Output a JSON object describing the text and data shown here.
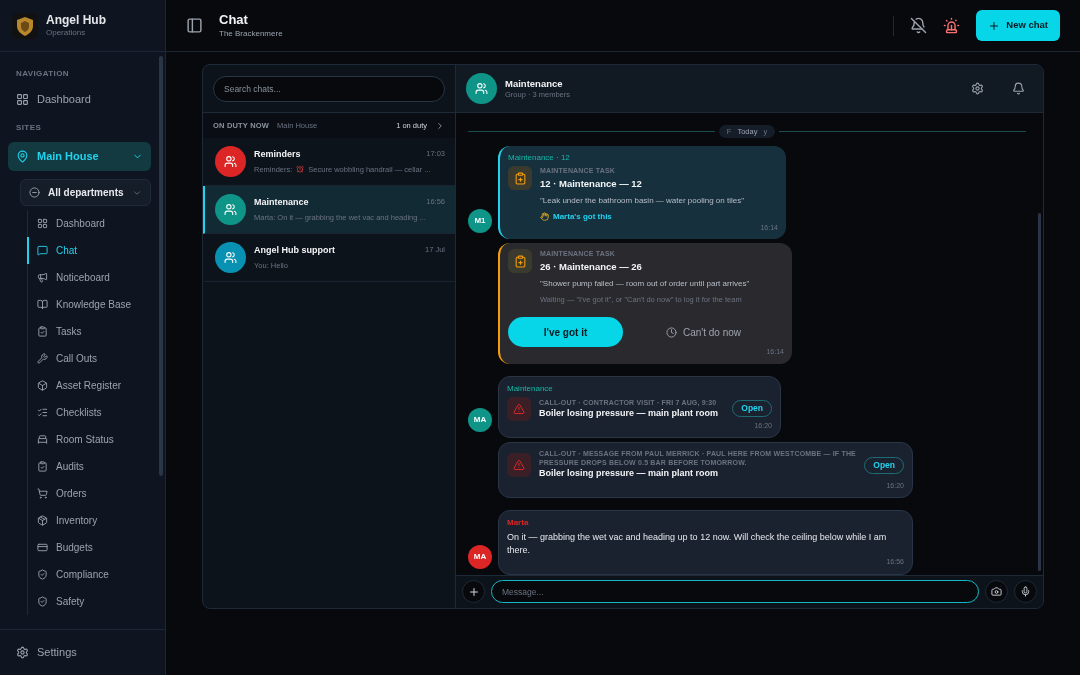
{
  "brand": {
    "name": "Angel Hub",
    "subtitle": "Operations"
  },
  "sidebar": {
    "nav_heading": "NAVIGATION",
    "nav_items": [
      {
        "label": "Dashboard",
        "selected": false
      }
    ],
    "sites_heading": "SITES",
    "site": {
      "label": "Main House"
    },
    "department": {
      "label": "All departments"
    },
    "items": [
      {
        "label": "Dashboard",
        "selected": false
      },
      {
        "label": "Chat",
        "selected": true
      },
      {
        "label": "Noticeboard",
        "selected": false
      },
      {
        "label": "Knowledge Base",
        "selected": false
      },
      {
        "label": "Tasks",
        "selected": false
      },
      {
        "label": "Call Outs",
        "selected": false
      },
      {
        "label": "Asset Register",
        "selected": false
      },
      {
        "label": "Checklists",
        "selected": false
      },
      {
        "label": "Room Status",
        "selected": false
      },
      {
        "label": "Audits",
        "selected": false
      },
      {
        "label": "Orders",
        "selected": false
      },
      {
        "label": "Inventory",
        "selected": false
      },
      {
        "label": "Budgets",
        "selected": false
      },
      {
        "label": "Compliance",
        "selected": false
      },
      {
        "label": "Safety",
        "selected": false
      }
    ],
    "settings": "Settings"
  },
  "header": {
    "title": "Chat",
    "subtitle": "The Brackenmere",
    "new_chat": "New chat"
  },
  "chat_list": {
    "search": {
      "placeholder": "Search chats..."
    },
    "on_duty": {
      "label": "ON DUTY NOW",
      "site": "Main House",
      "count": "1 on duty"
    },
    "chats": [
      {
        "name": "Reminders",
        "time": "17:03",
        "preview_prefix": "Reminders:",
        "preview": "Secure wobbling handrail — cellar ...",
        "color": "#dc2626",
        "selected": false
      },
      {
        "name": "Maintenance",
        "time": "16:56",
        "preview": "Marta: On it — grabbing the wet vac and heading ...",
        "color": "#0f9488",
        "selected": true
      },
      {
        "name": "Angel Hub support",
        "time": "17 Jul",
        "preview": "You: Hello",
        "color": "#0891b2",
        "selected": false
      }
    ]
  },
  "conversation": {
    "name": "Maintenance",
    "subtitle": "Group · 3 members",
    "date_pill": {
      "left": "F",
      "label": "Today",
      "right": "y"
    },
    "groups": [
      {
        "avatar": "M1",
        "color": "#0f9488",
        "messages": [
          {
            "kind": "task",
            "claimed": true,
            "sender": "Maintenance · 12",
            "label": "MAINTENANCE TASK",
            "title": "12 · Maintenance — 12",
            "quote": "\"Leak under the bathroom basin — water pooling on tiles\"",
            "status": "Marta's got this",
            "time": "16:14"
          },
          {
            "kind": "task",
            "claimed": false,
            "label": "MAINTENANCE TASK",
            "title": "26 · Maintenance — 26",
            "quote": "\"Shower pump failed — room out of order until part arrives\"",
            "status": "Waiting — \"I've got it\", or \"Can't do now\" to log it for the team",
            "accept": "I've got it",
            "decline": "Can't do now",
            "time": "16:14"
          }
        ]
      },
      {
        "avatar": "MA",
        "color": "#0f9488",
        "messages": [
          {
            "kind": "callout",
            "sender": "Maintenance",
            "label": "CALL-OUT · CONTRACTOR VISIT · FRI 7 AUG, 9:30",
            "title": "Boiler losing pressure — main plant room",
            "action": "Open",
            "time": "16:20"
          },
          {
            "kind": "callout",
            "label": "CALL-OUT · MESSAGE FROM PAUL MERRICK · PAUL HERE FROM WESTCOMBE — IF THE PRESSURE DROPS BELOW 0.5 BAR BEFORE TOMORROW.",
            "title": "Boiler losing pressure — main plant room",
            "action": "Open",
            "time": "16:20"
          }
        ]
      },
      {
        "avatar": "MA",
        "color": "#dc2626",
        "messages": [
          {
            "kind": "text",
            "sender": "Marta",
            "text": "On it — grabbing the wet vac and heading up to 12 now. Will check the ceiling below while I am there.",
            "time": "16:56"
          }
        ]
      }
    ],
    "composer": {
      "placeholder": "Message..."
    }
  }
}
